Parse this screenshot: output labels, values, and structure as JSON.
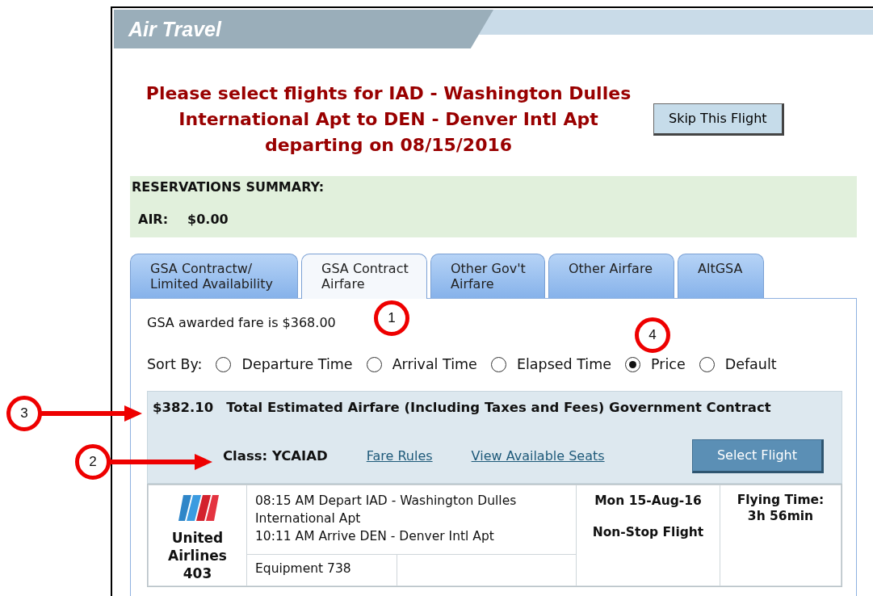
{
  "header": {
    "title": "Air Travel"
  },
  "prompt": {
    "text": "Please select flights for IAD - Washington Dulles International Apt to DEN - Denver Intl Apt departing on 08/15/2016",
    "button": "Skip This Flight"
  },
  "summary": {
    "title": "RESERVATIONS SUMMARY:",
    "label": "AIR:",
    "amount": "$0.00"
  },
  "tabs": [
    {
      "label": "GSA Contractw/ Limited Availability",
      "selected": false
    },
    {
      "label": "GSA Contract Airfare",
      "selected": true
    },
    {
      "label": "Other Gov't Airfare",
      "selected": false
    },
    {
      "label": "Other Airfare",
      "selected": false
    },
    {
      "label": "AltGSA",
      "selected": false
    }
  ],
  "awarded_fare": "GSA awarded fare is $368.00",
  "sort": {
    "label": "Sort By:",
    "options": [
      {
        "label": "Departure Time",
        "selected": false
      },
      {
        "label": "Arrival Time",
        "selected": false
      },
      {
        "label": "Elapsed Time",
        "selected": false
      },
      {
        "label": "Price",
        "selected": true
      },
      {
        "label": "Default",
        "selected": false
      }
    ]
  },
  "fare": {
    "amount": "$382.10",
    "description": "Total Estimated Airfare (Including Taxes and Fees) Government Contract",
    "class": "Class: YCAIAD",
    "links": [
      "Fare Rules",
      "View Available Seats"
    ],
    "button": "Select Flight"
  },
  "flight": {
    "airline": "United Airlines",
    "number": "403",
    "depart": "08:15 AM Depart IAD - Washington Dulles International Apt",
    "arrive": "10:11 AM Arrive DEN - Denver Intl Apt",
    "equipment": "Equipment 738",
    "date": "Mon 15-Aug-16",
    "stops": "Non-Stop Flight",
    "time_label": "Flying Time:",
    "time": "3h 56min"
  },
  "callouts": [
    {
      "number": "1",
      "kind": "circle"
    },
    {
      "number": "4",
      "kind": "circle"
    },
    {
      "number": "3",
      "kind": "arrow"
    },
    {
      "number": "2",
      "kind": "arrow"
    }
  ]
}
